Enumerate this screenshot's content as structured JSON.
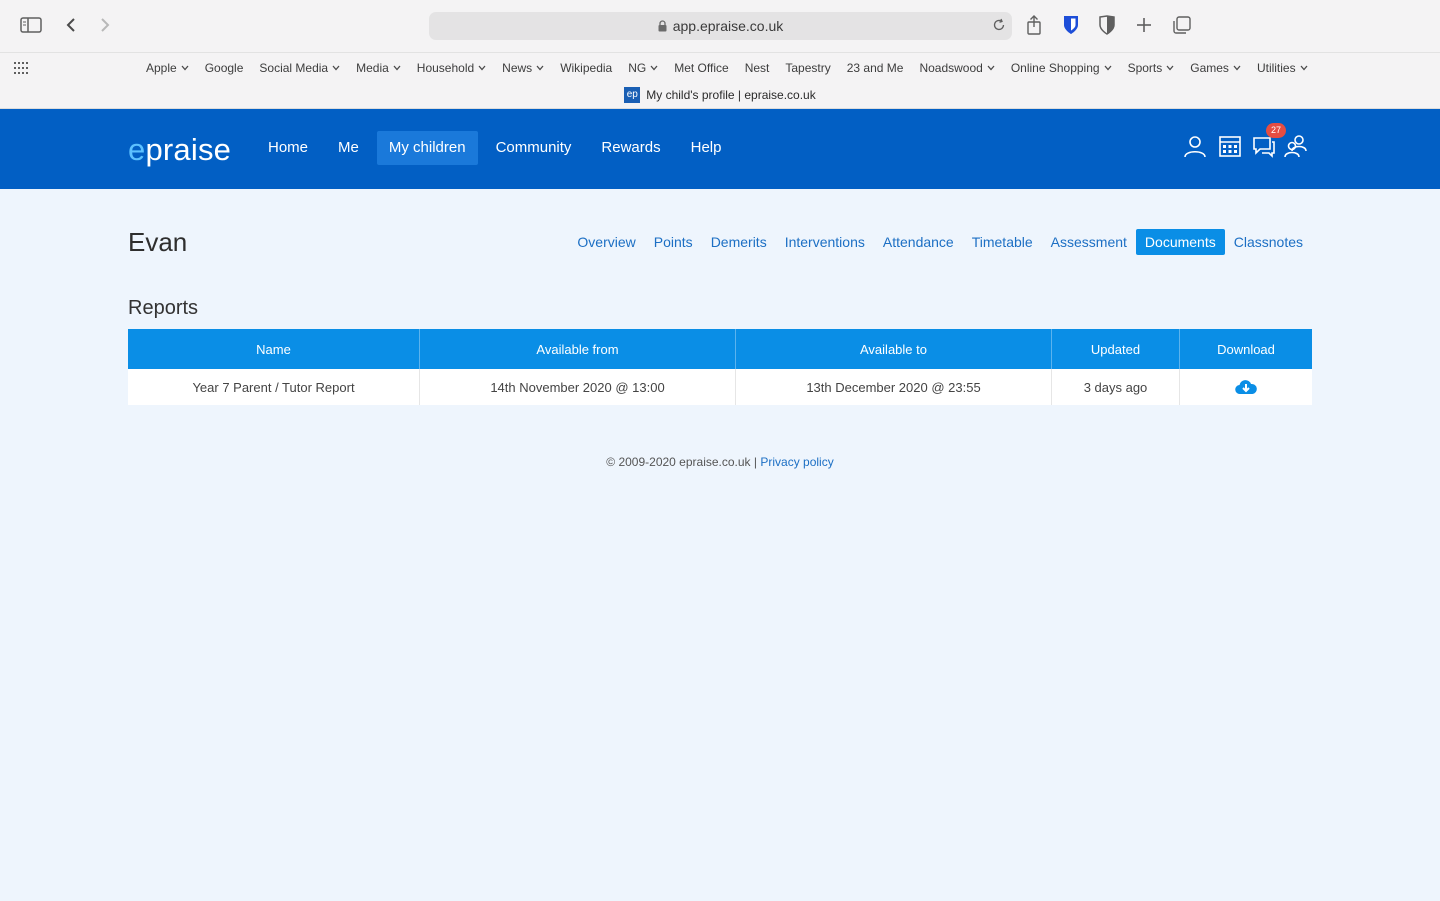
{
  "browser": {
    "url": "app.epraise.co.uk",
    "tab_title": "My child's profile | epraise.co.uk",
    "favicon_text": "ep",
    "bookmarks": [
      {
        "label": "Apple",
        "has_menu": true
      },
      {
        "label": "Google",
        "has_menu": false
      },
      {
        "label": "Social Media",
        "has_menu": true
      },
      {
        "label": "Media",
        "has_menu": true
      },
      {
        "label": "Household",
        "has_menu": true
      },
      {
        "label": "News",
        "has_menu": true
      },
      {
        "label": "Wikipedia",
        "has_menu": false
      },
      {
        "label": "NG",
        "has_menu": true
      },
      {
        "label": "Met Office",
        "has_menu": false
      },
      {
        "label": "Nest",
        "has_menu": false
      },
      {
        "label": "Tapestry",
        "has_menu": false
      },
      {
        "label": "23 and Me",
        "has_menu": false
      },
      {
        "label": "Noadswood",
        "has_menu": true
      },
      {
        "label": "Online Shopping",
        "has_menu": true
      },
      {
        "label": "Sports",
        "has_menu": true
      },
      {
        "label": "Games",
        "has_menu": true
      },
      {
        "label": "Utilities",
        "has_menu": true
      }
    ]
  },
  "site": {
    "logo_e": "e",
    "logo_rest": "praise",
    "nav": [
      {
        "label": "Home",
        "active": false
      },
      {
        "label": "Me",
        "active": false
      },
      {
        "label": "My children",
        "active": true
      },
      {
        "label": "Community",
        "active": false
      },
      {
        "label": "Rewards",
        "active": false
      },
      {
        "label": "Help",
        "active": false
      }
    ],
    "messages_badge": "27"
  },
  "page": {
    "child_name": "Evan",
    "subnav": [
      {
        "label": "Overview",
        "active": false
      },
      {
        "label": "Points",
        "active": false
      },
      {
        "label": "Demerits",
        "active": false
      },
      {
        "label": "Interventions",
        "active": false
      },
      {
        "label": "Attendance",
        "active": false
      },
      {
        "label": "Timetable",
        "active": false
      },
      {
        "label": "Assessment",
        "active": false
      },
      {
        "label": "Documents",
        "active": true
      },
      {
        "label": "Classnotes",
        "active": false
      }
    ],
    "section_title": "Reports",
    "table": {
      "headers": [
        "Name",
        "Available from",
        "Available to",
        "Updated",
        "Download"
      ],
      "rows": [
        {
          "name": "Year 7 Parent / Tutor Report",
          "available_from": "14th November 2020 @ 13:00",
          "available_to": "13th December 2020 @ 23:55",
          "updated": "3 days ago",
          "download_icon": "cloud-download-icon"
        }
      ]
    },
    "footer": {
      "copyright": "© 2009-2020 epraise.co.uk |",
      "privacy_link": "Privacy policy"
    }
  },
  "colors": {
    "header_blue": "#025fc4",
    "accent_blue": "#0a8ee6",
    "link_blue": "#1c6fc4",
    "badge_red": "#e54d42",
    "page_bg": "#eef5fd"
  }
}
